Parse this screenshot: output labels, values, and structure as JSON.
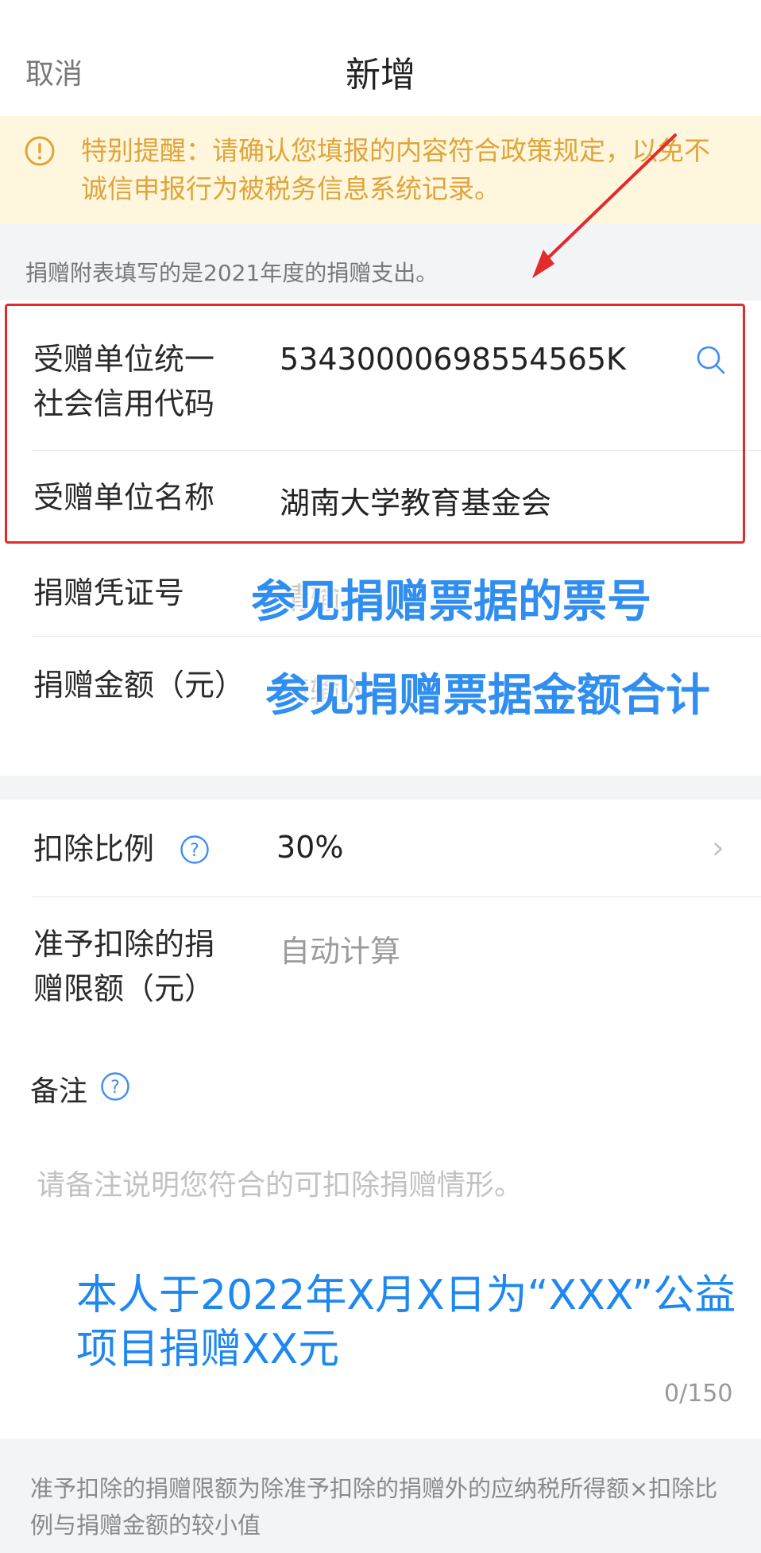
{
  "header": {
    "cancel_label": "取消",
    "title": "新增"
  },
  "notice": {
    "icon": "warning-circle-icon",
    "text": "特别提醒：请确认您填报的内容符合政策规定，以免不诚信申报行为被税务信息系统记录。"
  },
  "hint": "捐赠附表填写的是2021年度的捐赠支出。",
  "fields": {
    "credit_code": {
      "label": "受赠单位统一社会信用代码",
      "value": "53430000698554565K",
      "icon": "search-icon"
    },
    "org_name": {
      "label": "受赠单位名称",
      "value": "湖南大学教育基金会"
    },
    "voucher_no": {
      "label": "捐赠凭证号",
      "placeholder": "请输入",
      "annotation": "参见捐赠票据的票号"
    },
    "amount": {
      "label": "捐赠金额（元）",
      "placeholder": "请输入",
      "annotation": "参见捐赠票据金额合计"
    },
    "ratio": {
      "label": "扣除比例",
      "value": "30%",
      "icon": "help-circle-icon"
    },
    "limit": {
      "label": "准予扣除的捐赠限额（元）",
      "value": "自动计算"
    }
  },
  "remark": {
    "label": "备注",
    "placeholder": "请备注说明您符合的可扣除捐赠情形。",
    "annotation": "本人于2022年X月X日为“XXX”公益项目捐赠XX元",
    "counter": "0/150"
  },
  "footer_note": "准予扣除的捐赠限额为除准予扣除的捐赠外的应纳税所得额×扣除比例与捐赠金额的较小值",
  "colors": {
    "highlight_box": "#e32b2b",
    "annotation_blue": "#2f8ef0",
    "notice_text": "#e0a43a"
  }
}
